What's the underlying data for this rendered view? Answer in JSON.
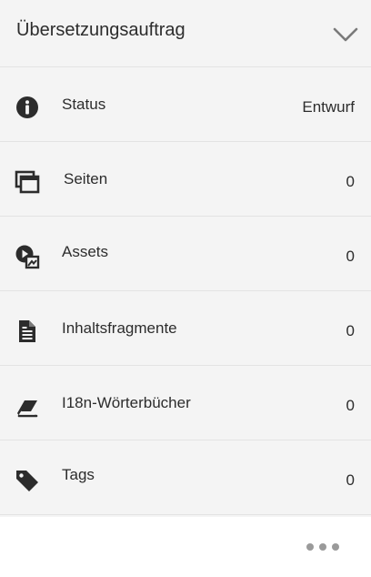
{
  "panel": {
    "title": "Übersetzungsauftrag",
    "collapse_icon": "chevron-down-icon"
  },
  "rows": [
    {
      "label": "Status",
      "value": "Entwurf",
      "icon": "info-icon"
    },
    {
      "label": "Seiten",
      "value": "0",
      "icon": "pages-icon"
    },
    {
      "label": "Assets",
      "value": "0",
      "icon": "assets-icon"
    },
    {
      "label": "Inhaltsfragmente",
      "value": "0",
      "icon": "content-fragment-icon"
    },
    {
      "label": "I18n-Wörterbücher",
      "value": "0",
      "icon": "dictionary-icon"
    },
    {
      "label": "Tags",
      "value": "0",
      "icon": "tag-icon"
    }
  ],
  "footer": {
    "more_icon": "more-icon"
  },
  "colors": {
    "panel_bg": "#f4f4f4",
    "divider": "#e3e3e3",
    "text": "#2c2c2c",
    "icon": "#2c2c2c",
    "muted_icon": "#999999"
  }
}
